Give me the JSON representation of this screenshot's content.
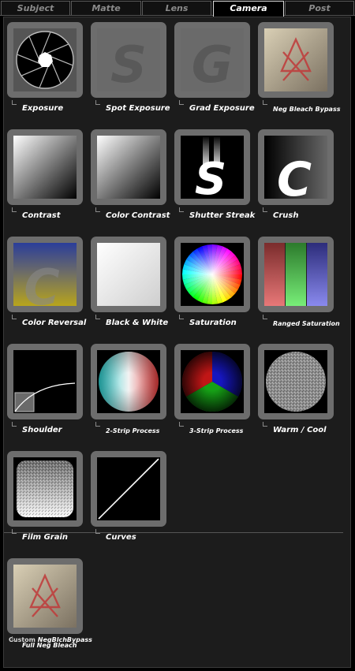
{
  "tabs": [
    {
      "label": "Subject",
      "active": false
    },
    {
      "label": "Matte",
      "active": false
    },
    {
      "label": "Lens",
      "active": false
    },
    {
      "label": "Camera",
      "active": true
    },
    {
      "label": "Post",
      "active": false
    }
  ],
  "presets": [
    {
      "label": "Exposure",
      "icon": "aperture-icon"
    },
    {
      "label": "Spot Exposure",
      "icon": "letter-s-icon"
    },
    {
      "label": "Grad Exposure",
      "icon": "letter-g-icon"
    },
    {
      "label": "Neg Bleach Bypass",
      "icon": "bleach-symbol-icon"
    },
    {
      "label": "Contrast",
      "icon": "gradient-square-icon"
    },
    {
      "label": "Color Contrast",
      "icon": "gradient-square-icon"
    },
    {
      "label": "Shutter Streak",
      "icon": "letter-s-streak-icon"
    },
    {
      "label": "Crush",
      "icon": "letter-c-icon"
    },
    {
      "label": "Color Reversal",
      "icon": "letter-c-gradient-icon"
    },
    {
      "label": "Black & White",
      "icon": "white-gradient-icon"
    },
    {
      "label": "Saturation",
      "icon": "color-wheel-icon"
    },
    {
      "label": "Ranged Saturation",
      "icon": "rgb-bars-icon"
    },
    {
      "label": "Shoulder",
      "icon": "curve-shoulder-icon"
    },
    {
      "label": "2-Strip Process",
      "icon": "cyan-red-sphere-icon"
    },
    {
      "label": "3-Strip Process",
      "icon": "rgb-sphere-icon"
    },
    {
      "label": "Warm / Cool",
      "icon": "gray-sphere-icon"
    },
    {
      "label": "Film Grain",
      "icon": "grain-square-icon"
    },
    {
      "label": "Curves",
      "icon": "diagonal-line-icon"
    }
  ],
  "custom_preset": {
    "label": "Full Neg Bleach",
    "icon": "bleach-symbol-icon",
    "caption_prefix": "Custom",
    "caption_name": "NegBlchBypass"
  }
}
